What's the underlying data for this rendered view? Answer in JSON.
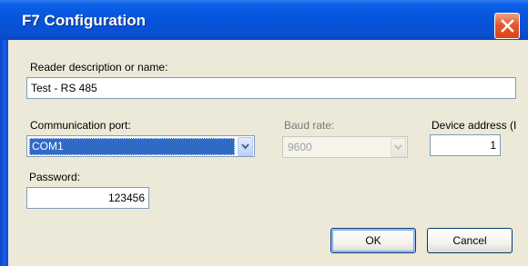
{
  "window": {
    "title": "F7 Configuration",
    "close_icon": "close-icon"
  },
  "form": {
    "reader_label": "Reader description or name:",
    "reader_value": "Test - RS 485",
    "port_label": "Communication port:",
    "port_value": "COM1",
    "baud_label": "Baud rate:",
    "baud_value": "9600",
    "device_label": "Device address (I",
    "device_value": "1",
    "password_label": "Password:",
    "password_value": "123456"
  },
  "buttons": {
    "ok": "OK",
    "cancel": "Cancel"
  },
  "colors": {
    "titlebar": "#0654dc",
    "dialog_background": "#ece9d8",
    "selection": "#316ac5",
    "close_button": "#e2592f"
  }
}
